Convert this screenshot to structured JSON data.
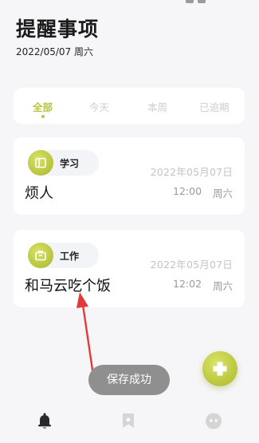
{
  "header": {
    "title": "提醒事项",
    "date": "2022/05/07 周六"
  },
  "tabs": [
    {
      "label": "全部",
      "active": true
    },
    {
      "label": "今天",
      "active": false
    },
    {
      "label": "本周",
      "active": false
    },
    {
      "label": "已逾期",
      "active": false
    }
  ],
  "reminders": [
    {
      "category": "学习",
      "category_icon": "book-icon",
      "date": "2022年05月07日",
      "time": "12:00",
      "weekday": "周六",
      "title": "烦人"
    },
    {
      "category": "工作",
      "category_icon": "briefcase-icon",
      "date": "2022年05月07日",
      "time": "12:02",
      "weekday": "周六",
      "title": "和马云吃个饭"
    }
  ],
  "toast": "保存成功",
  "fab_icon": "add-icon",
  "bottom_nav": [
    {
      "icon": "bell-icon",
      "active": true
    },
    {
      "icon": "bookmark-icon",
      "active": false
    },
    {
      "icon": "profile-icon",
      "active": false
    }
  ],
  "colors": {
    "accent": "#b8c73a",
    "background": "#f6f6f8",
    "card": "#ffffff",
    "toast": "#8f8f8f",
    "annotation_arrow": "#e03a3a"
  }
}
